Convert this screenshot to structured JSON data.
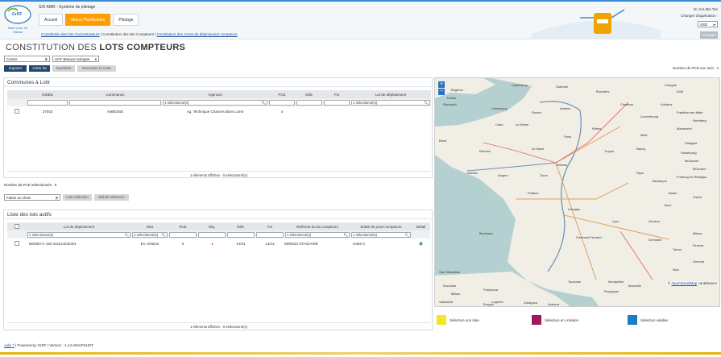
{
  "header": {
    "app_title": "SID AMR - Système de pilotage",
    "logo_text": "GrDF",
    "logo_slogan": "Avec vous, en réseau",
    "nav": [
      "Accueil",
      "Macro Planification",
      "Pilotage"
    ],
    "breadcrumb": {
      "link1": "Constitution des lots Concentrateurs",
      "sep": " | ",
      "current": "Constitution des lots Compteurs",
      "sep2": " | ",
      "link2": "Constitution des zones de déploiement compteurs"
    },
    "user": "M. SALIBA Ton",
    "change_app_label": "Changer d'application :",
    "app_select_value": "SSD",
    "change_button": "Changer"
  },
  "page": {
    "title_prefix": "CONSTITUTION DES",
    "title_bold": "LOTS COMPTEURS"
  },
  "filters": {
    "region": "Centre",
    "ucf": "UCF Beauce Sologne"
  },
  "toolbar": {
    "import": "Importer",
    "create_lot": "Créer lot",
    "synthesis": "Synthèse",
    "recenter": "Recentrer la carte"
  },
  "pce_non_lotis": "Nombre de PCE non lotis : 4",
  "communes": {
    "title": "Communes à Lotir",
    "columns": [
      "INSEE",
      "Communes",
      "Agences",
      "PCE",
      "Déb.",
      "Fin",
      "Lot de déploiement"
    ],
    "agences_filter": "1 sélectionné(s)",
    "lot_filter": "1 sélectionné(s)",
    "row": {
      "insee": "37003",
      "commune": "AMBOISE",
      "agence": "Ag. Technique Chartres Blois Loiret",
      "pce": "4"
    },
    "footer": "1 éléments affichés - 0 sélectionné(s)",
    "selected_count": "Nombre de PCE sélectionnés : 0",
    "action_select": "Faites un choix",
    "lot_selection": "Lotir sélection",
    "unlot_selection": "Délotir sélection"
  },
  "lots": {
    "title": "Liste des lots actifs",
    "columns": [
      "Lot de déploiement",
      "Etat",
      "PCE",
      "Obj.",
      "Déb.",
      "Fin",
      "Référent du lot compteurs",
      "Entité de pose compteurs",
      "Détail"
    ],
    "filter_lot": "1 sélectionné(s)",
    "filter_etat": "1 sélectionné(s)",
    "filter_ref": "1 sélectionné(s)",
    "filter_entite": "1 sélectionné(s)",
    "row": {
      "lot": "Belloti0-C-162-ssss14042301",
      "etat": "En création",
      "pce": "0",
      "obj": "-1",
      "deb": "14/01",
      "fin": "14/12",
      "referent": "MR6033 STAGIAIRE",
      "entite": "entité Z"
    },
    "footer": "1 éléments affichés - 0 sélectionné(s)"
  },
  "map": {
    "zoom_in": "+",
    "zoom_out": "−",
    "attribution_link": "OpenStreetMap",
    "attribution_text": "contributors",
    "attribution_prefix": "©",
    "cities": [
      "Canterbury",
      "Brighton",
      "Ostende",
      "Bruxelles",
      "Cologne",
      "Köln",
      "Koblenz",
      "Frankfurt am Main",
      "Exeter",
      "Plymouth",
      "Cherbourg",
      "Caen",
      "Rouen",
      "Amiens",
      "Charleroi",
      "Luxembourg",
      "Mannheim",
      "Nurnberg",
      "Le Havre",
      "Reims",
      "Metz",
      "Nancy",
      "Strasbourg",
      "Stuttgart",
      "Brest",
      "Rennes",
      "Le Mans",
      "Paris",
      "Orléans",
      "Troyes",
      "Dijon",
      "Mulhouse",
      "Freiburg im Breisgau",
      "München",
      "Nantes",
      "Angers",
      "Tours",
      "Besançon",
      "Basel",
      "Zürich",
      "Bern",
      "Genève",
      "Poitiers",
      "Limoges",
      "Lyon",
      "Grenoble",
      "Milano",
      "Torino",
      "Bordeaux",
      "Clermont-Ferrand",
      "Genova",
      "Toulouse",
      "Montpellier",
      "Marseille",
      "Nice",
      "Donostia",
      "San Sebastián",
      "Pamplona",
      "Bilbao",
      "Logroño",
      "Zaragoza",
      "Andorra",
      "Perpignan",
      "Valladolid",
      "Burgos",
      "Firenze"
    ]
  },
  "legend": [
    {
      "label": "Sélection non lotie",
      "color": "#f5e625"
    },
    {
      "label": "Sélection en création",
      "color": "#a0195f"
    },
    {
      "label": "Sélection validée",
      "color": "#1a7fc1"
    }
  ],
  "footer": {
    "help": "Aide ?",
    "text": " | Powered by GrDF | Version : 1.4.5-SNAPSHOT"
  }
}
